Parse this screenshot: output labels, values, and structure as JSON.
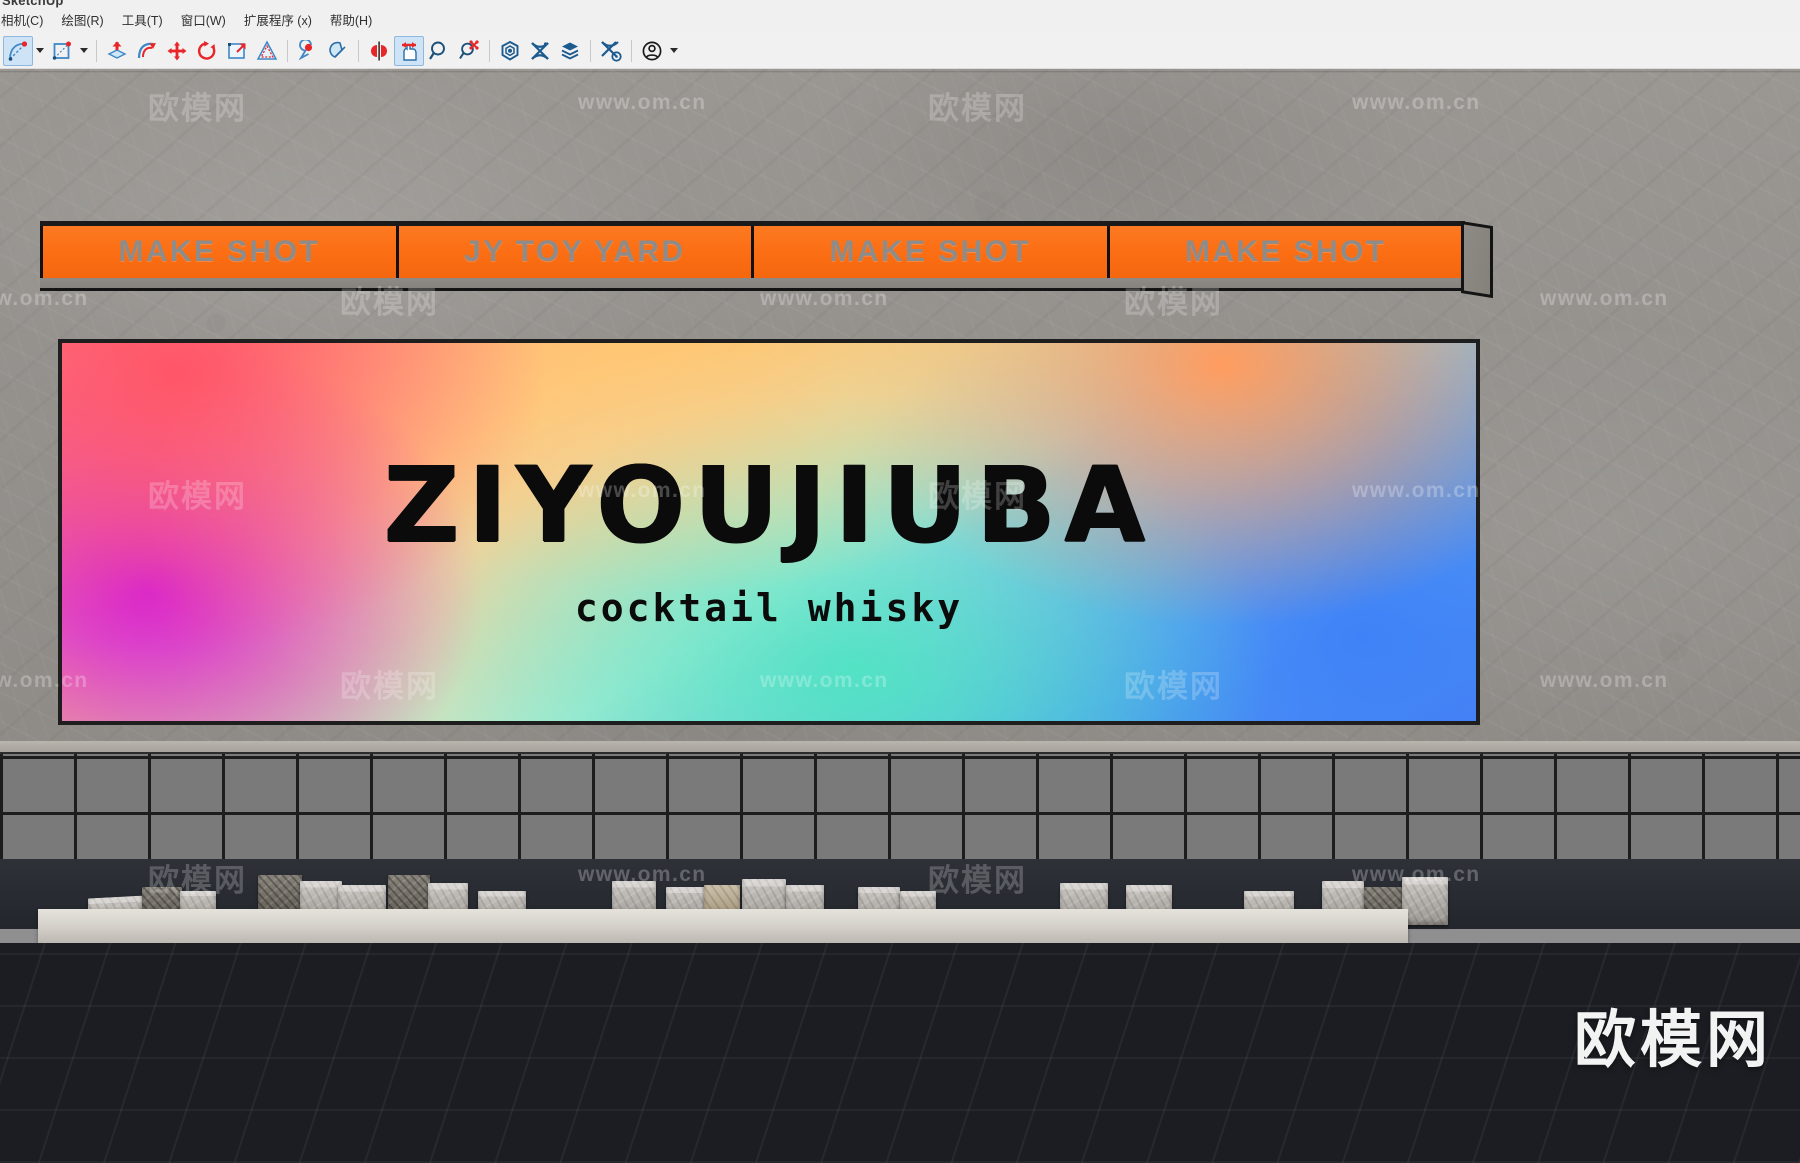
{
  "window": {
    "title": "SketchUp"
  },
  "menu": {
    "items": [
      {
        "label": "相机(C)"
      },
      {
        "label": "绘图(R)"
      },
      {
        "label": "工具(T)"
      },
      {
        "label": "窗口(W)"
      },
      {
        "label": "扩展程序 (x)"
      },
      {
        "label": "帮助(H)"
      }
    ]
  },
  "toolbar": {
    "groups": [
      {
        "buttons": [
          {
            "icon": "arc-tool-icon",
            "active": true,
            "dropdown": true
          },
          {
            "icon": "rectangle-tool-icon",
            "active": false,
            "dropdown": true
          }
        ]
      },
      {
        "buttons": [
          {
            "icon": "push-pull-icon",
            "active": false,
            "dropdown": false
          },
          {
            "icon": "follow-me-icon",
            "active": false,
            "dropdown": false
          },
          {
            "icon": "move-icon",
            "active": false,
            "dropdown": false
          },
          {
            "icon": "rotate-icon",
            "active": false,
            "dropdown": false
          },
          {
            "icon": "scale-icon",
            "active": false,
            "dropdown": false
          },
          {
            "icon": "offset-icon",
            "active": false,
            "dropdown": false
          }
        ]
      },
      {
        "buttons": [
          {
            "icon": "paint-bucket-icon",
            "active": false,
            "dropdown": false
          },
          {
            "icon": "eraser-icon",
            "active": false,
            "dropdown": false
          }
        ]
      },
      {
        "buttons": [
          {
            "icon": "mirror-icon",
            "active": false,
            "dropdown": false
          },
          {
            "icon": "grab-pan-icon",
            "active": true,
            "dropdown": false
          },
          {
            "icon": "zoom-icon",
            "active": false,
            "dropdown": false
          },
          {
            "icon": "zoom-extents-icon",
            "active": false,
            "dropdown": false
          }
        ]
      },
      {
        "buttons": [
          {
            "icon": "component-icon",
            "active": false,
            "dropdown": false
          },
          {
            "icon": "mesh-smooth-icon",
            "active": false,
            "dropdown": false
          },
          {
            "icon": "layers-stack-icon",
            "active": false,
            "dropdown": false
          }
        ]
      },
      {
        "buttons": [
          {
            "icon": "mesh-settings-icon",
            "active": false,
            "dropdown": false
          }
        ]
      },
      {
        "buttons": [
          {
            "icon": "account-icon",
            "active": false,
            "dropdown": true
          }
        ]
      }
    ]
  },
  "scene": {
    "sign_band": {
      "panels": [
        {
          "label": "MAKE SHOT"
        },
        {
          "label": "JY TOY YARD"
        },
        {
          "label": "MAKE SHOT"
        },
        {
          "label": "MAKE SHOT"
        }
      ],
      "panel_color": "#FB6E14",
      "text_color": "#8d8c8a",
      "frame_color": "#141414"
    },
    "led_sign": {
      "title": "ZIYOUJIUBA",
      "subtitle": "cocktail  whisky",
      "text_color": "#0b0b0b",
      "gradient_stops": [
        "#ff5668",
        "#d21ee0",
        "#ffc266",
        "#46e0c0",
        "#4f7df3"
      ],
      "frame_color": "#1e1e1e"
    },
    "wall_color": "#95928e",
    "tile_wall_color": "#7a7a7a",
    "floor_color": "#1b1d22",
    "ledge_color": "#d3cfc8"
  },
  "watermarks": {
    "brand": "欧模网",
    "url": "www.om.cn",
    "corner_brand": "欧模网"
  }
}
